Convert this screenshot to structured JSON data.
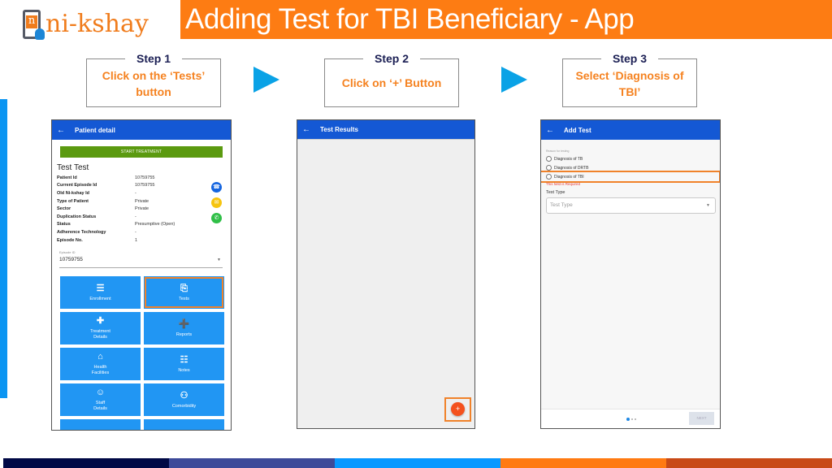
{
  "logo": {
    "text": "ni-kshay",
    "badge_letter": "n"
  },
  "title": "Adding Test for TBI Beneficiary - App",
  "steps": [
    {
      "label": "Step 1",
      "description": "Click on the ‘Tests’ button"
    },
    {
      "label": "Step 2",
      "description": "Click on ‘+’ Button"
    },
    {
      "label": "Step 3",
      "description": "Select ‘Diagnosis of TBI’"
    }
  ],
  "colors": {
    "title_bar": "#fd7c13",
    "step_label": "#1b1f54",
    "step_desc": "#f58220",
    "arrow": "#0aa2e6",
    "app_bar": "#1458d4",
    "highlight": "#f0822a",
    "bottom_strip": [
      "#000845",
      "#3d4a99",
      "#0898ff",
      "#ff7a12",
      "#c84a17"
    ]
  },
  "screen1": {
    "app_bar_title": "Patient detail",
    "back_icon": "←",
    "start_treatment": "START TREATMENT",
    "patient_name": "Test Test",
    "fields": [
      {
        "key": "Patient Id",
        "value": "10759755"
      },
      {
        "key": "Current Episode Id",
        "value": "10759755"
      },
      {
        "key": "Old Ni-kshay Id",
        "value": "-"
      },
      {
        "key": "Type of Patient",
        "value": "Private"
      },
      {
        "key": "Sector",
        "value": "Private"
      },
      {
        "key": "Duplication Status",
        "value": "-"
      },
      {
        "key": "Status",
        "value": "Presumptive (Open)"
      },
      {
        "key": "Adherence Technology",
        "value": "-"
      },
      {
        "key": "Episode No.",
        "value": "1"
      }
    ],
    "contact_icons": [
      "phone-icon",
      "message-icon",
      "whatsapp-icon"
    ],
    "episode_label": "Episode ID",
    "episode_value": "10759755",
    "tiles": [
      {
        "label": "Enrollment",
        "icon": "☰"
      },
      {
        "label": "Tests",
        "icon": "⎘"
      },
      {
        "label": "Treatment\nDetails",
        "icon": "✚"
      },
      {
        "label": "Reports",
        "icon": "➕"
      },
      {
        "label": "Health\nFacilities",
        "icon": "⌂"
      },
      {
        "label": "Notes",
        "icon": "☷"
      },
      {
        "label": "Staff\nDetails",
        "icon": "☺"
      },
      {
        "label": "Comorbidity",
        "icon": "⚇"
      },
      {
        "label": "",
        "icon": "☻"
      },
      {
        "label": "",
        "icon": "◎"
      }
    ]
  },
  "screen2": {
    "app_bar_title": "Test Results",
    "back_icon": "←",
    "fab_label": "+"
  },
  "screen3": {
    "app_bar_title": "Add Test",
    "back_icon": "←",
    "reason_label": "Reason for testing",
    "options": [
      "Diagnosis of TB",
      "Diagnosis of DRTB",
      "Diagnosis of TBI"
    ],
    "error_text": "This field is Required",
    "test_type_label": "Test Type",
    "test_type_placeholder": "Test Type",
    "next_label": "NEXT",
    "page_indicator": {
      "current": 1,
      "total": 3
    }
  }
}
